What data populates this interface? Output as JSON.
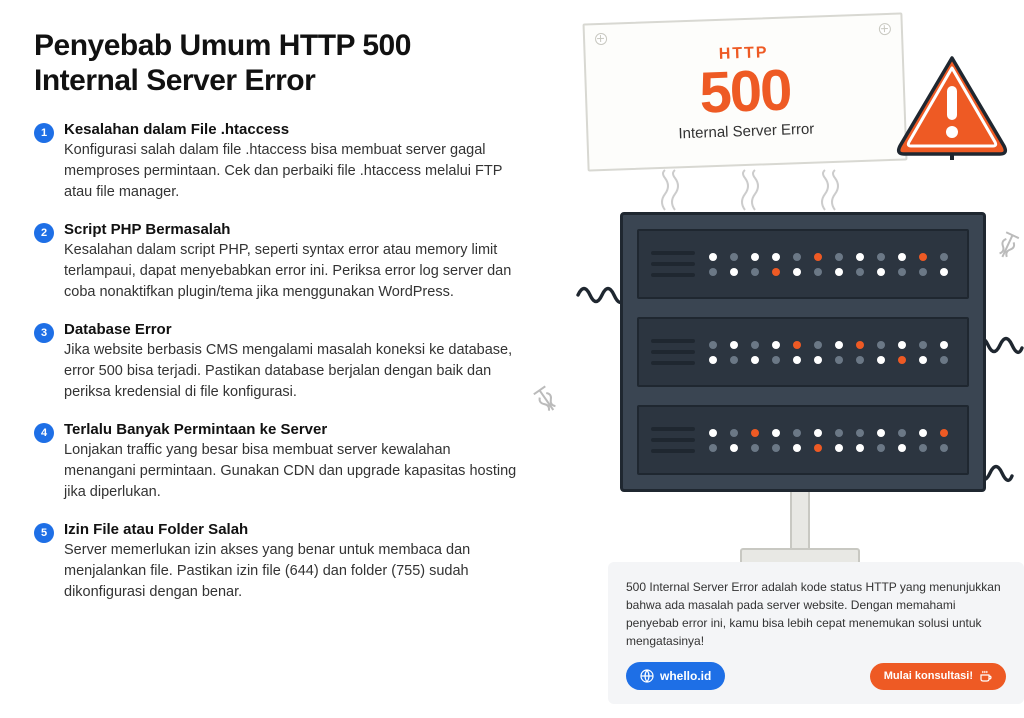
{
  "title": "Penyebab Umum HTTP 500 Internal Server Error",
  "items": [
    {
      "num": "1",
      "title": "Kesalahan dalam File .htaccess",
      "text": "Konfigurasi salah dalam file .htaccess bisa membuat server gagal memproses permintaan. Cek dan perbaiki file .htaccess melalui FTP atau file manager."
    },
    {
      "num": "2",
      "title": "Script PHP Bermasalah",
      "text": "Kesalahan dalam script PHP, seperti syntax error atau memory limit terlampaui, dapat menyebabkan error ini. Periksa error log server dan coba nonaktifkan plugin/tema jika menggunakan WordPress."
    },
    {
      "num": "3",
      "title": "Database Error",
      "text": "Jika website berbasis CMS mengalami masalah koneksi ke database, error 500 bisa terjadi. Pastikan database berjalan dengan baik dan periksa kredensial di file konfigurasi."
    },
    {
      "num": "4",
      "title": "Terlalu Banyak Permintaan ke Server",
      "text": "Lonjakan traffic yang besar bisa membuat server kewalahan menangani permintaan. Gunakan CDN dan upgrade kapasitas hosting jika diperlukan."
    },
    {
      "num": "5",
      "title": "Izin File atau Folder Salah",
      "text": "Server memerlukan izin akses yang benar untuk membaca dan menjalankan file. Pastikan izin file (644) dan folder (755) sudah dikonfigurasi dengan benar."
    }
  ],
  "sign": {
    "http": "HTTP",
    "code": "500",
    "sub": "Internal Server Error"
  },
  "footer": {
    "text": "500 Internal Server Error adalah kode status HTTP yang menunjukkan bahwa ada masalah pada server website. Dengan memahami penyebab error ini, kamu bisa lebih cepat menemukan solusi untuk mengatasinya!",
    "brand": "whello.id",
    "cta": "Mulai konsultasi!"
  },
  "colors": {
    "accent_orange": "#ee5a24",
    "accent_blue": "#1e6fe6",
    "server_dark": "#3a4552"
  }
}
